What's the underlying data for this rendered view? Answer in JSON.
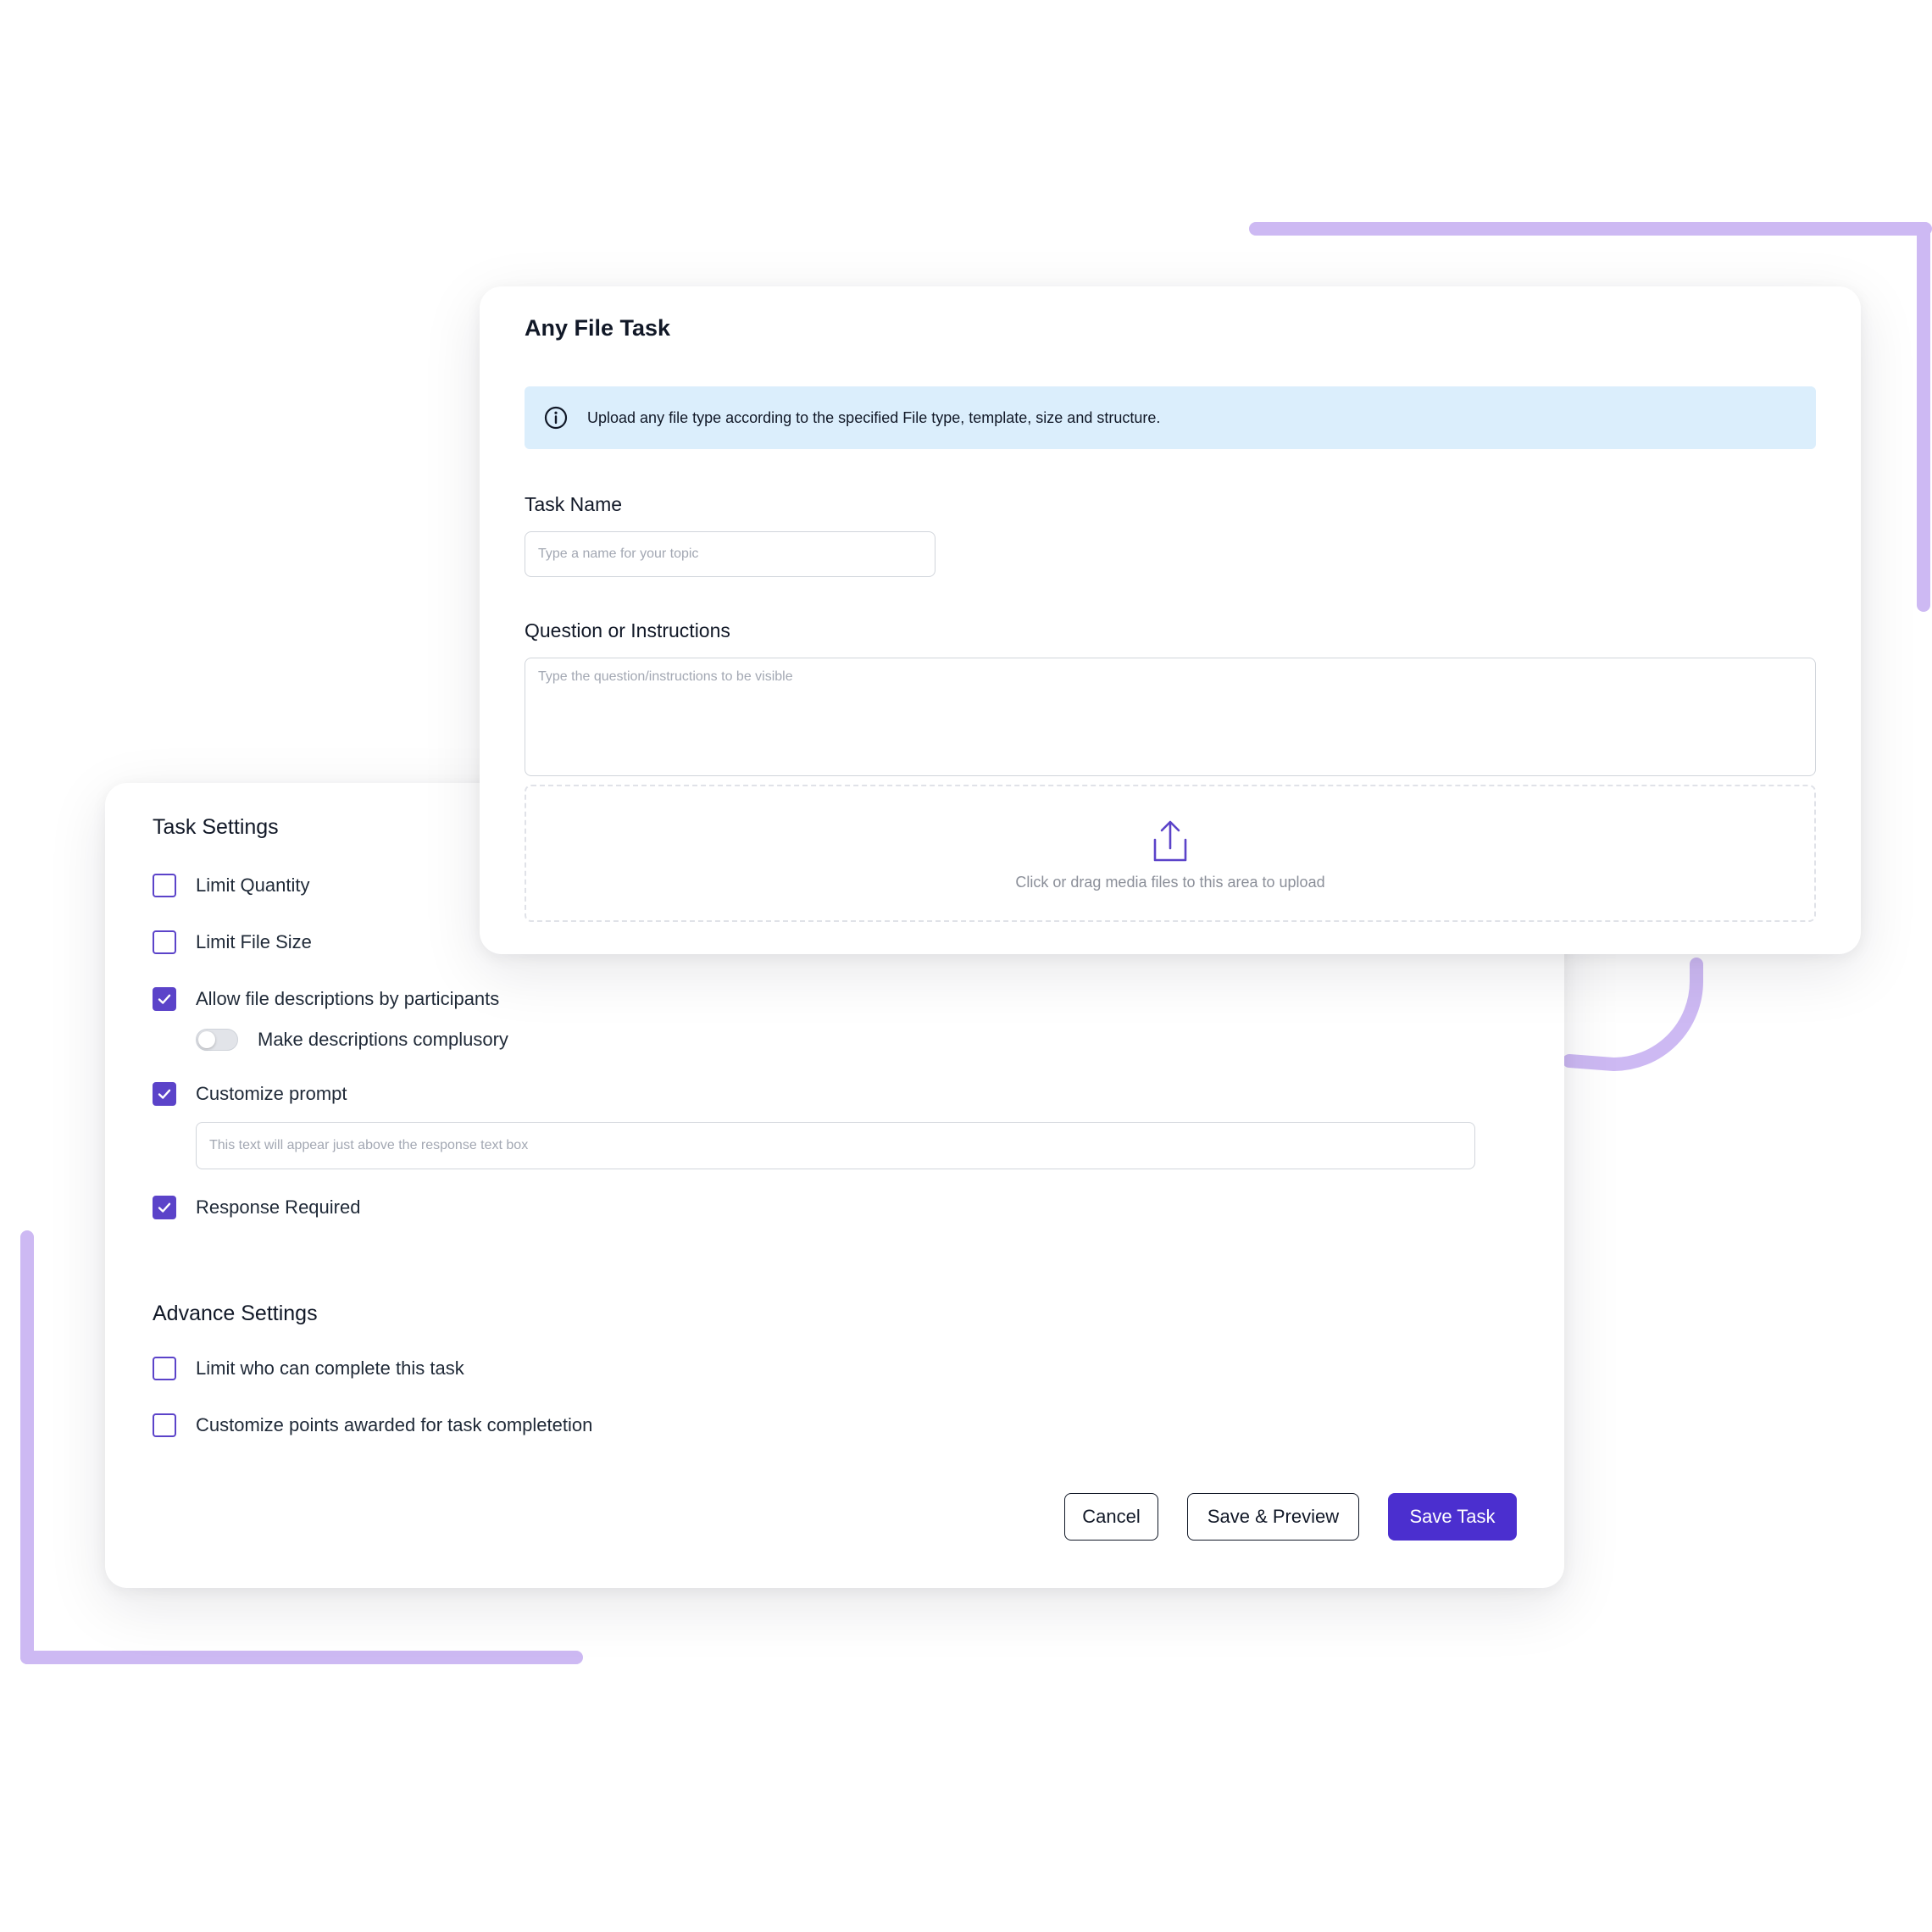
{
  "colors": {
    "accent": "#4b2fcf",
    "checkbox": "#5b43c9",
    "decoration": "#cdb9f3",
    "info_banner": "#dbeefc"
  },
  "task_card": {
    "title": "Any File Task",
    "info_icon": "info-circle-icon",
    "info_text": "Upload any file type according to the specified File type, template, size and structure.",
    "task_name_label": "Task Name",
    "task_name_placeholder": "Type a name for your topic",
    "question_label": "Question or Instructions",
    "question_placeholder": "Type the question/instructions to be visible",
    "upload_icon": "upload-icon",
    "upload_text": "Click or drag media files to this area to upload"
  },
  "settings_card": {
    "task_settings_title": "Task Settings",
    "limit_quantity": {
      "label": "Limit Quantity",
      "checked": false
    },
    "limit_file_size": {
      "label": "Limit File Size",
      "checked": false
    },
    "allow_descriptions": {
      "label": "Allow file descriptions by participants",
      "checked": true
    },
    "descriptions_toggle": {
      "label": "Make descriptions complusory",
      "on": false
    },
    "customize_prompt": {
      "label": "Customize prompt",
      "checked": true
    },
    "prompt_placeholder": "This text will appear just above the response text box",
    "response_required": {
      "label": "Response Required",
      "checked": true
    },
    "advance_settings_title": "Advance Settings",
    "limit_who": {
      "label": "Limit who can complete this task",
      "checked": false
    },
    "customize_points": {
      "label": "Customize points awarded for task completetion",
      "checked": false
    },
    "buttons": {
      "cancel": "Cancel",
      "save_preview": "Save & Preview",
      "save_task": "Save Task"
    }
  }
}
